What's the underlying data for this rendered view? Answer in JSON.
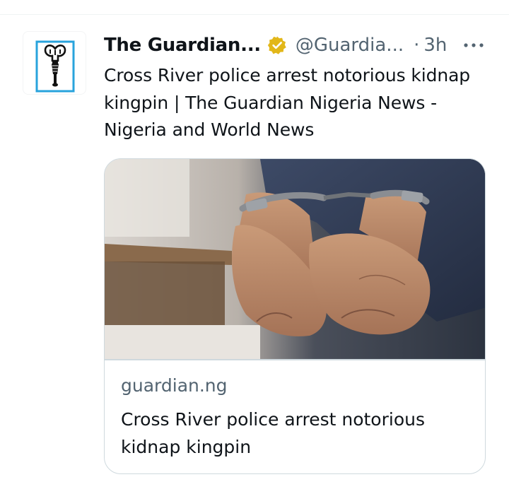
{
  "tweet": {
    "display_name": "The Guardian...",
    "handle": "@Guardia...",
    "separator": "·",
    "time": "3h",
    "verified_icon": "verified-badge-gold",
    "more_icon": "more-horizontal-icon",
    "avatar_icon": "guardian-nigeria-logo",
    "text": "Cross River police arrest notorious kidnap kingpin | The Guardian Nigeria News - Nigeria and World News"
  },
  "card": {
    "image_subject": "handcuffed-hands-photo",
    "domain": "guardian.ng",
    "title": "Cross River police arrest notorious kidnap kingpin"
  },
  "colors": {
    "text_primary": "#0f1419",
    "text_secondary": "#536471",
    "border": "#cfd9de",
    "verified_gold": "#e2b719",
    "logo_blue": "#28a3dc"
  }
}
